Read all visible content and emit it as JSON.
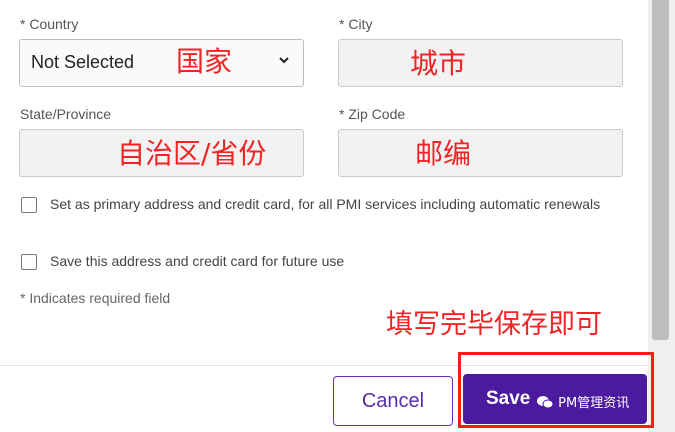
{
  "form": {
    "country": {
      "label": "* Country",
      "value": "Not Selected",
      "annotation": "国家"
    },
    "city": {
      "label": "* City",
      "value": "",
      "annotation": "城市"
    },
    "state": {
      "label": "State/Province",
      "value": "",
      "annotation": "自治区/省份"
    },
    "zip": {
      "label": "* Zip Code",
      "value": "",
      "annotation": "邮编"
    },
    "checkbox_primary": {
      "label": "Set as primary address and credit card, for all PMI services including automatic renewals",
      "checked": false
    },
    "checkbox_save": {
      "label": "Save this address and credit card for future use",
      "checked": false
    },
    "required_note": "* Indicates required field"
  },
  "annotation_main": "填写完毕保存即可",
  "footer": {
    "cancel_label": "Cancel",
    "save_label": "Save"
  },
  "watermark": "PM管理资讯",
  "colors": {
    "accent": "#4c1a9f",
    "annotation": "#f02424",
    "field_bg": "#f2f2f2"
  }
}
